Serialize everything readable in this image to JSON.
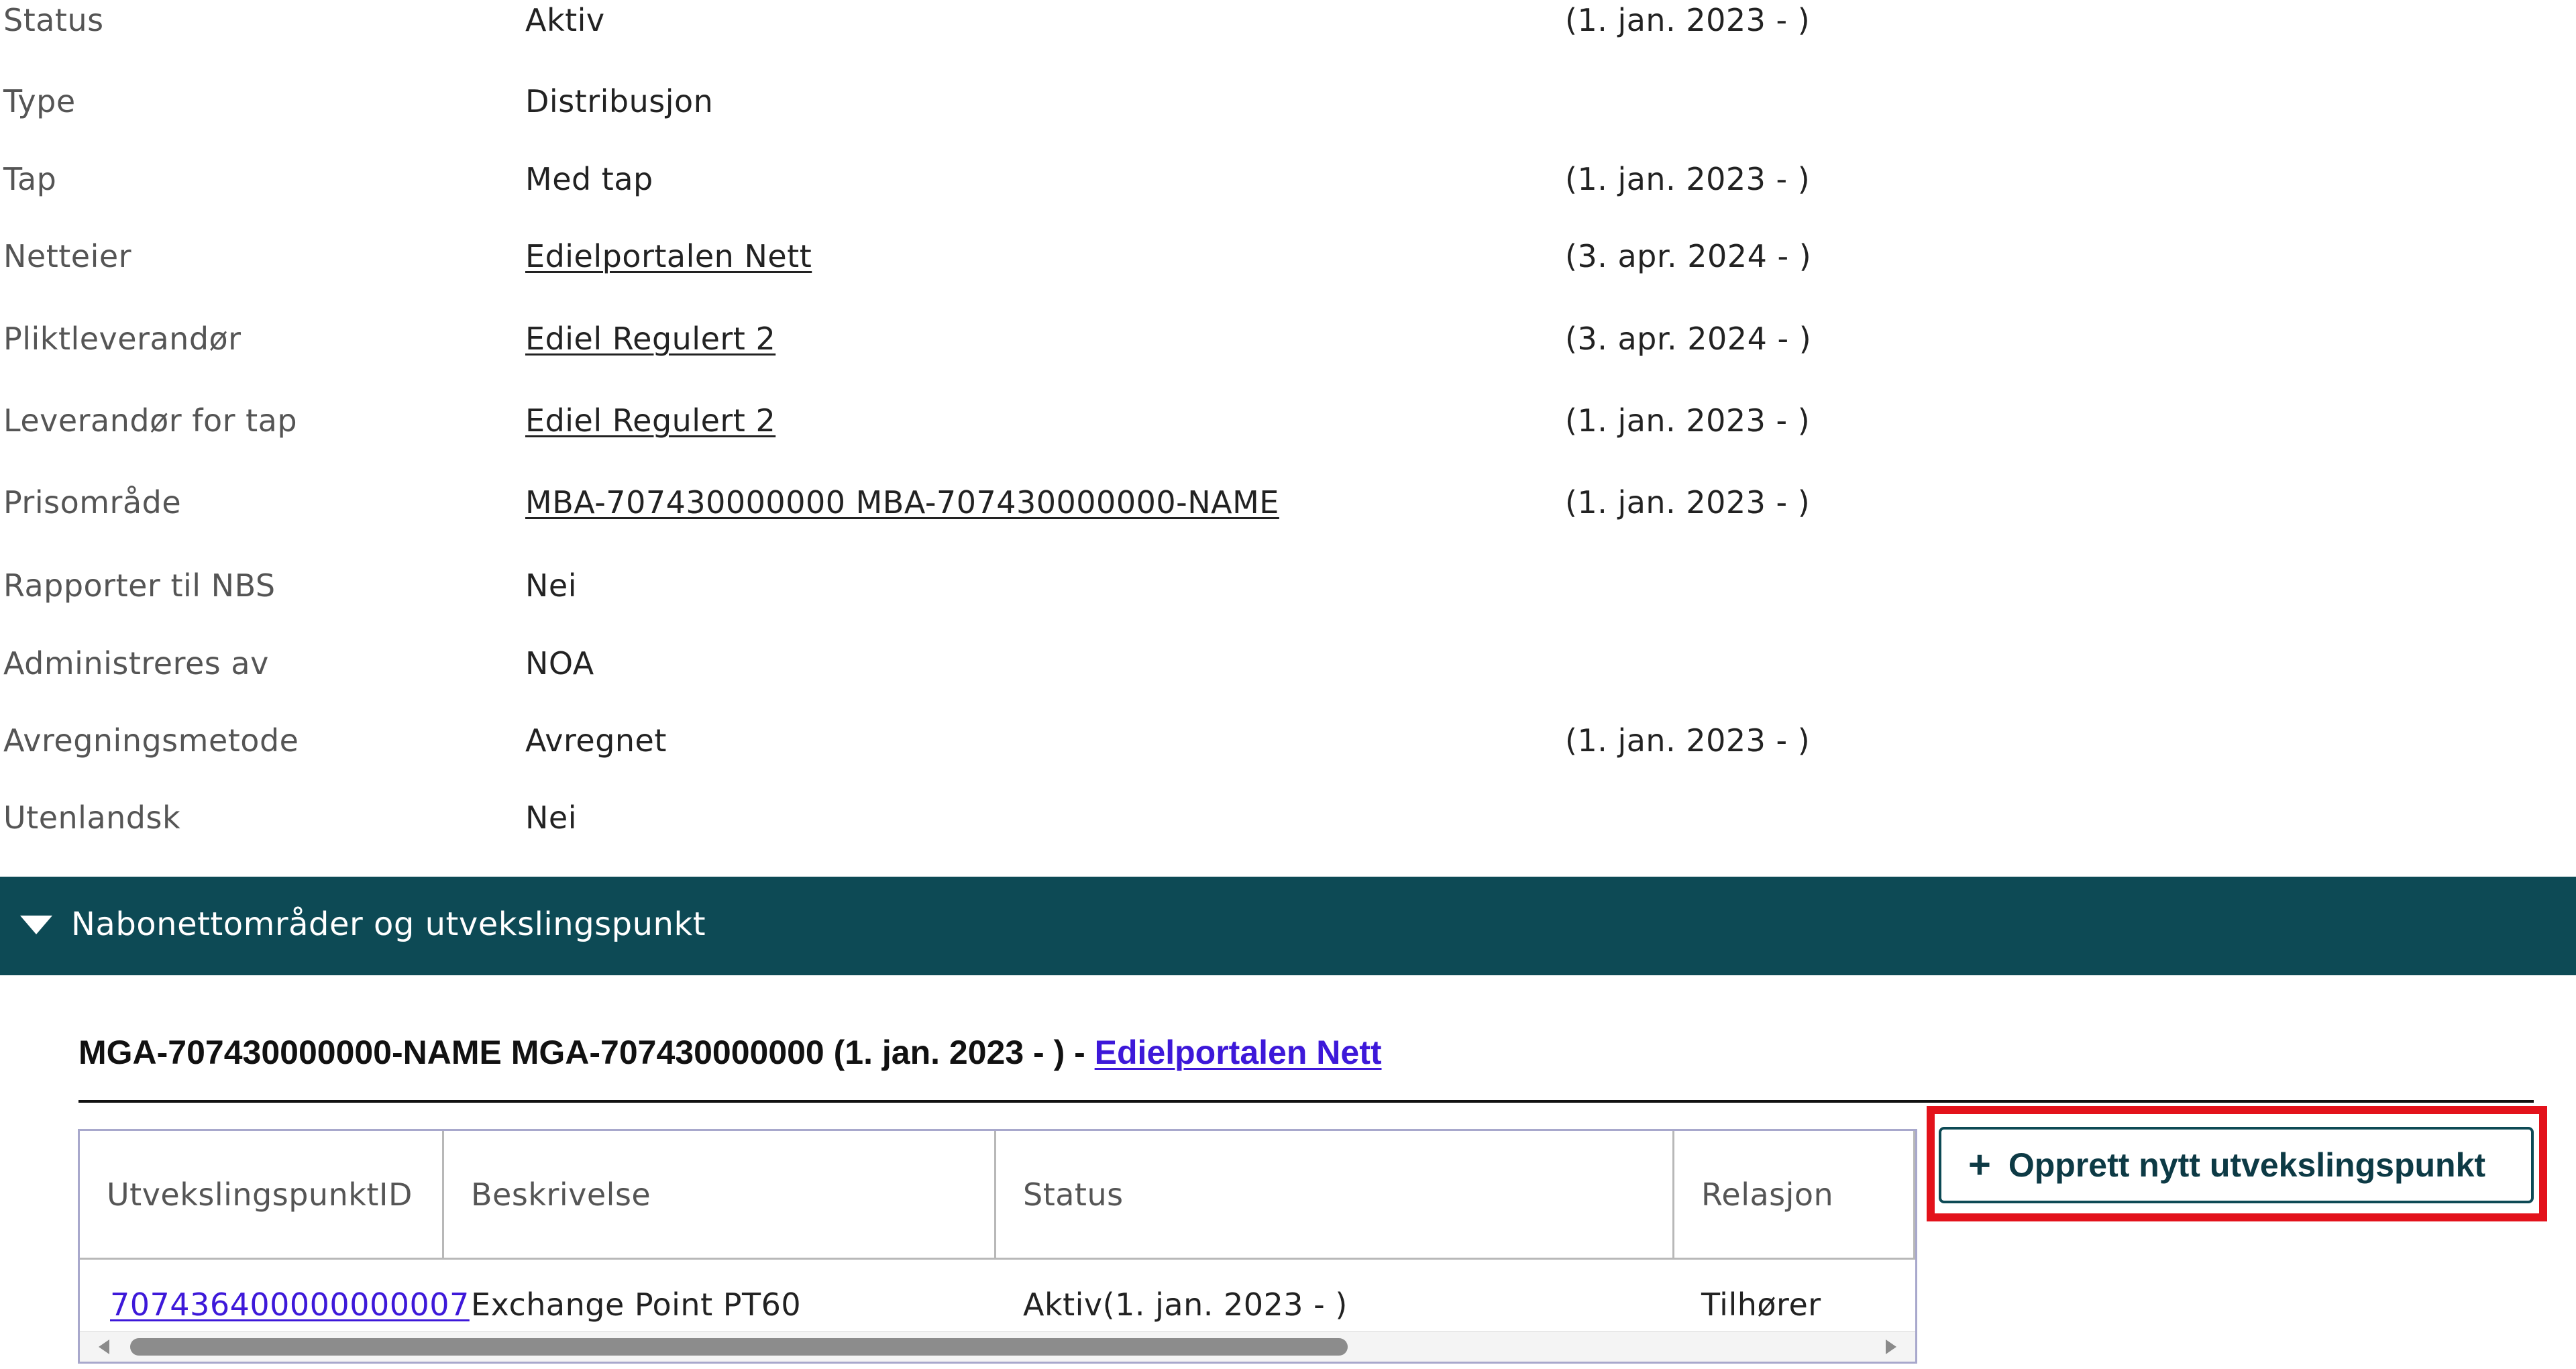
{
  "details": [
    {
      "label": "Status",
      "value": "Aktiv",
      "link": false,
      "period": "(1. jan. 2023 - )"
    },
    {
      "label": "Type",
      "value": "Distribusjon",
      "link": false,
      "period": ""
    },
    {
      "label": "Tap",
      "value": "Med tap",
      "link": false,
      "period": "(1. jan. 2023 - )"
    },
    {
      "label": "Netteier",
      "value": "Edielportalen Nett",
      "link": true,
      "period": "(3. apr. 2024 - )"
    },
    {
      "label": "Pliktleverandør",
      "value": "Ediel Regulert 2",
      "link": true,
      "period": "(3. apr. 2024 - )"
    },
    {
      "label": "Leverandør for tap",
      "value": "Ediel Regulert 2",
      "link": true,
      "period": "(1. jan. 2023 - )"
    },
    {
      "label": "Prisområde",
      "value": "MBA-707430000000 MBA-707430000000-NAME",
      "link": true,
      "period": "(1. jan. 2023 - )"
    },
    {
      "label": "Rapporter til NBS",
      "value": "Nei",
      "link": false,
      "period": ""
    },
    {
      "label": "Administreres av",
      "value": "NOA",
      "link": false,
      "period": ""
    },
    {
      "label": "Avregningsmetode",
      "value": "Avregnet",
      "link": false,
      "period": "(1. jan. 2023 - )"
    },
    {
      "label": "Utenlandsk",
      "value": "Nei",
      "link": false,
      "period": ""
    }
  ],
  "section": {
    "title": "Nabonettområder og utvekslingspunkt",
    "icon": "caret-down-icon"
  },
  "neighbor": {
    "heading_text": "MGA-707430000000-NAME MGA-707430000000 (1. jan. 2023 - ) - ",
    "heading_link": "Edielportalen Nett"
  },
  "table": {
    "columns": [
      "UtvekslingspunktID",
      "Beskrivelse",
      "Status",
      "Relasjon"
    ],
    "rows": [
      {
        "id": "707436400000000007",
        "description": "Exchange Point PT60",
        "status": "Aktiv(1. jan. 2023 - )",
        "relation": "Tilhører"
      }
    ]
  },
  "create_button": {
    "label": "Opprett nytt utvekslingspunkt",
    "icon": "plus-icon",
    "icon_glyph": "+"
  },
  "colors": {
    "header_bg": "#0d4a55",
    "link": "#3d18d9",
    "highlight": "#e3121b"
  }
}
